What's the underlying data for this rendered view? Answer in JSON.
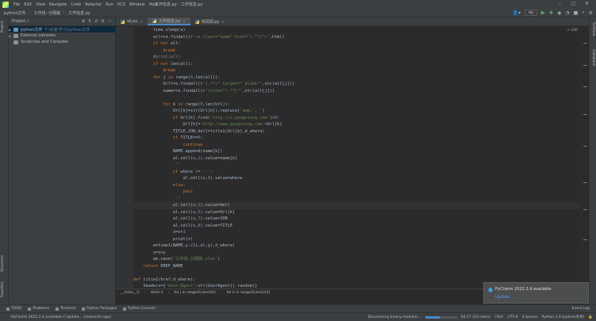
{
  "window": {
    "title": "工作信息.py - 工作信息.py"
  },
  "menu": [
    "File",
    "Edit",
    "View",
    "Navigate",
    "Code",
    "Refactor",
    "Run",
    "VCS",
    "Window",
    "Help"
  ],
  "breadcrumbs": [
    "python文件",
    "工作找--分隔装",
    "工作信息.py"
  ],
  "run_config": "wj",
  "project": {
    "header": "Project",
    "tree": [
      {
        "label": "python文件",
        "path": "F:\\桌面\\学习\\python文件"
      },
      {
        "label": "External Libraries"
      },
      {
        "label": "Scratches and Consoles"
      }
    ]
  },
  "tabs": [
    {
      "label": "wj.py"
    },
    {
      "label": "工作信息.py"
    },
    {
      "label": "林调调.py"
    }
  ],
  "inspection": "⚠ 240",
  "code_lines": [
    {
      "n": "40",
      "text": "        time.sleep(a)"
    },
    {
      "n": "41",
      "text": "        all=re.findall(r'<a class=\"name\" href=\"(.*?)\">',html)"
    },
    {
      "n": "42",
      "text": "        if not all:"
    },
    {
      "n": "43",
      "text": "            break"
    },
    {
      "n": "44",
      "text": "        #print(all)"
    },
    {
      "n": "45",
      "text": "        if not len(all):"
    },
    {
      "n": "46",
      "text": "            break"
    },
    {
      "n": "47",
      "text": "        for j in range(0,len(all)):"
    },
    {
      "n": "48",
      "text": "            Url=re.findall(r'(.*?)\" target=\"_blank\"',str(all[j]))"
    },
    {
      "n": "49",
      "text": "            name=re.findall(r'title=\"(.*?)\"',str(all[j]))"
    },
    {
      "n": "50",
      "text": ""
    },
    {
      "n": "51",
      "text": "            for k in range(0,len(Url)):"
    },
    {
      "n": "52",
      "text": "                Url[k]=str(Url[k]).replace('amp;','')"
    },
    {
      "n": "53",
      "text": "                if Url[k].find('http://z.gongxiong.com')<0:"
    },
    {
      "n": "54",
      "text": "                    Url[k]='http://www.gongxiong.com'+Url[k]"
    },
    {
      "n": "55",
      "text": "                TITLE,JOB,dell=title1(Url[k],d_where)"
    },
    {
      "n": "56",
      "text": "                if TITLE==0:"
    },
    {
      "n": "57",
      "text": "                    continue"
    },
    {
      "n": "58",
      "text": "                NAME.append(name[k])"
    },
    {
      "n": "59",
      "text": "                al.cell(x,1).value=name[k]"
    },
    {
      "n": "60",
      "text": "                '''"
    },
    {
      "n": "61",
      "text": "                if where != '-':"
    },
    {
      "n": "62",
      "text": "                    al.cell(x,4).value=where"
    },
    {
      "n": "63",
      "text": "                else:"
    },
    {
      "n": "64",
      "text": "                    pass"
    },
    {
      "n": "65",
      "text": "                '''"
    },
    {
      "n": "66",
      "text": "                al.cell(x,2).value=dell"
    },
    {
      "n": "67",
      "text": "                al.cell(x,5).value=Url[k]"
    },
    {
      "n": "68",
      "text": "                al.cell(x,7).value=JOB"
    },
    {
      "n": "69",
      "text": "                al.cell(x,8).value=TITLE"
    },
    {
      "n": "70",
      "text": "                x=x+1"
    },
    {
      "n": "71",
      "text": "                print(x)"
    },
    {
      "n": "72",
      "text": "        w=time1(NAME,y-2(i,al,y),d_where)"
    },
    {
      "n": "73",
      "text": "        y=x+y"
    },
    {
      "n": "74",
      "text": "        wb.save('工作找-分隔装.xlsx')"
    },
    {
      "n": "75",
      "text": "    return HREF_NAME"
    },
    {
      "n": "76",
      "text": ""
    },
    {
      "n": "77",
      "text": "def title1(href,d_where):"
    },
    {
      "n": "78",
      "text": "    headers={'User-Agent':str(UserAgent().random)}"
    },
    {
      "n": "79",
      "text": "    content=requests.get(href,headers=headers,timeout=30).text"
    }
  ],
  "current_line_index": 26,
  "editor_breadcrumb": [
    "__main__()",
    "while a",
    "for j in range(0,len(all))",
    "for k in range(0,len(Url))"
  ],
  "tool_windows": [
    "TODO",
    "Problems",
    "Terminal",
    "Python Packages",
    "Python Console"
  ],
  "event_log": "Event Log",
  "notification": {
    "title": "PyCharm 2022.2.4 available",
    "link": "Update..."
  },
  "status": {
    "message": "PyCharm 2022.2.4 available // Update... (moments ago)",
    "task": "Discovering binary modules...",
    "progress": 0.45,
    "position": "64:17 (23 chars)",
    "line_sep": "CRLF",
    "encoding": "UTF-8",
    "indent": "4 spaces",
    "interpreter": "Python 3.9 (python文件)"
  },
  "side_tabs": {
    "left": [
      "Project",
      "Structure",
      "Favorites"
    ],
    "right": [
      "SciView",
      "Database"
    ]
  }
}
